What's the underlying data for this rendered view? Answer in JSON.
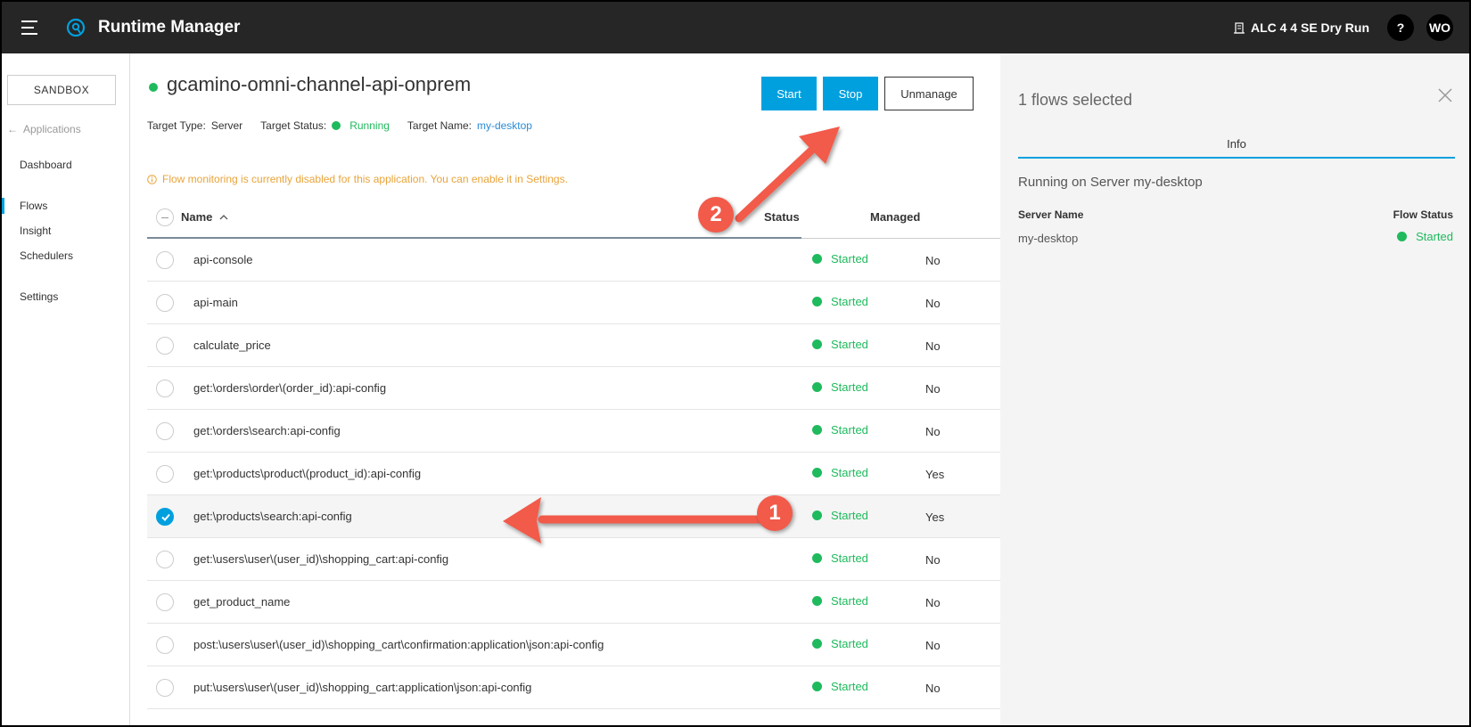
{
  "topbar": {
    "title": "Runtime Manager",
    "org_name": "ALC 4 4 SE Dry Run",
    "help_label": "?",
    "user_initials": "WO"
  },
  "sidebar": {
    "environment": "SANDBOX",
    "back_label": "Applications",
    "items": [
      {
        "label": "Dashboard"
      },
      {
        "label": "Flows"
      },
      {
        "label": "Insight"
      },
      {
        "label": "Schedulers"
      },
      {
        "label": "Settings"
      }
    ]
  },
  "app": {
    "name": "gcamino-omni-channel-api-onprem",
    "target_type_label": "Target Type:",
    "target_type": "Server",
    "target_status_label": "Target Status:",
    "target_status": "Running",
    "target_name_label": "Target Name:",
    "target_name": "my-desktop"
  },
  "actions": {
    "start": "Start",
    "stop": "Stop",
    "unmanage": "Unmanage"
  },
  "warning": "Flow monitoring is currently disabled for this application. You can enable it in Settings.",
  "table": {
    "headers": {
      "name": "Name",
      "status": "Status",
      "managed": "Managed"
    },
    "rows": [
      {
        "name": "api-console",
        "status": "Started",
        "managed": "No"
      },
      {
        "name": "api-main",
        "status": "Started",
        "managed": "No"
      },
      {
        "name": "calculate_price",
        "status": "Started",
        "managed": "No"
      },
      {
        "name": "get:\\orders\\order\\(order_id):api-config",
        "status": "Started",
        "managed": "No"
      },
      {
        "name": "get:\\orders\\search:api-config",
        "status": "Started",
        "managed": "No"
      },
      {
        "name": "get:\\products\\product\\(product_id):api-config",
        "status": "Started",
        "managed": "Yes"
      },
      {
        "name": "get:\\products\\search:api-config",
        "status": "Started",
        "managed": "Yes"
      },
      {
        "name": "get:\\users\\user\\(user_id)\\shopping_cart:api-config",
        "status": "Started",
        "managed": "No"
      },
      {
        "name": "get_product_name",
        "status": "Started",
        "managed": "No"
      },
      {
        "name": "post:\\users\\user\\(user_id)\\shopping_cart\\confirmation:application\\json:api-config",
        "status": "Started",
        "managed": "No"
      },
      {
        "name": "put:\\users\\user\\(user_id)\\shopping_cart:application\\json:api-config",
        "status": "Started",
        "managed": "No"
      }
    ]
  },
  "panel": {
    "title": "1 flows selected",
    "tab": "Info",
    "subtitle": "Running on Server my-desktop",
    "server_name_label": "Server Name",
    "flow_status_label": "Flow Status",
    "server_name": "my-desktop",
    "flow_status": "Started"
  },
  "annotations": {
    "badge_1": "1",
    "badge_2": "2"
  },
  "colors": {
    "accent": "#00a0df",
    "success": "#1fba5d",
    "warning": "#e9a43a",
    "annotation": "#f25a4a",
    "topbar": "#262626"
  }
}
